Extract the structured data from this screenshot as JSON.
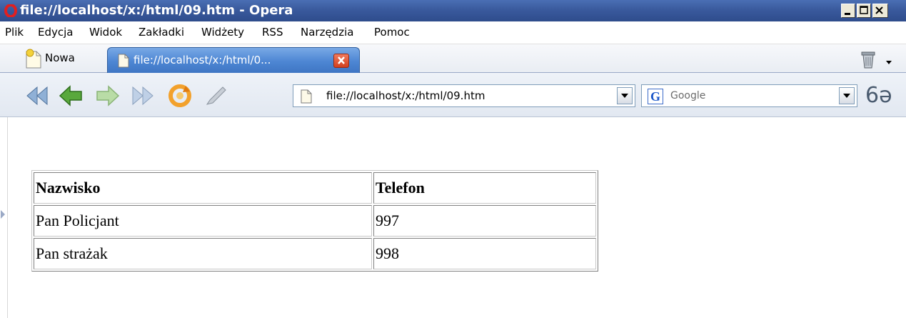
{
  "window": {
    "title": "file://localhost/x:/html/09.htm - Opera"
  },
  "menu": [
    "Plik",
    "Edycja",
    "Widok",
    "Zakładki",
    "Widżety",
    "RSS",
    "Narzędzia",
    "Pomoc"
  ],
  "tabs": {
    "new_tab_label": "Nowa",
    "active_tab_label": "file://localhost/x:/html/0..."
  },
  "toolbar": {
    "address": "file://localhost/x:/html/09.htm",
    "search_placeholder": "Google",
    "search_engine_letter": "G",
    "glasses_glyph": "6ә"
  },
  "table": {
    "headers": [
      "Nazwisko",
      "Telefon"
    ],
    "rows": [
      [
        "Pan Policjant",
        "997"
      ],
      [
        "Pan strażak",
        "998"
      ]
    ]
  },
  "colors": {
    "titlebar": "#3a5a9d",
    "active_tab": "#4d86d3",
    "close_tab": "#d2401f"
  }
}
